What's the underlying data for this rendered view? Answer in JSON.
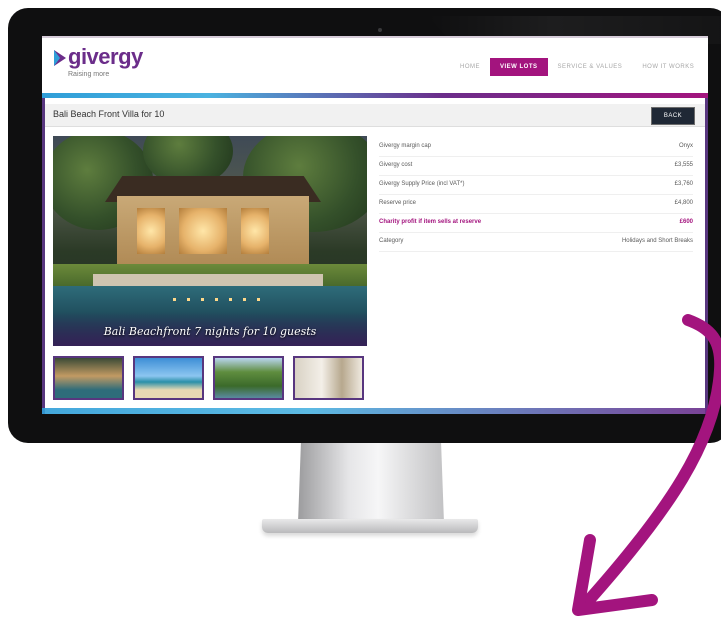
{
  "site": {
    "logo_text": "givergy",
    "logo_tagline": "Raising more"
  },
  "nav": {
    "items": [
      {
        "label": "HOME",
        "active": false
      },
      {
        "label": "VIEW LOTS",
        "active": true
      },
      {
        "label": "SERVICE & VALUES",
        "active": false
      },
      {
        "label": "HOW IT WORKS",
        "active": false
      }
    ]
  },
  "page": {
    "title": "Bali Beach Front Villa for 10",
    "back_label": "BACK",
    "photo_caption": "Bali Beachfront 7 nights for 10 guests"
  },
  "details": [
    {
      "label": "Givergy margin cap",
      "value": "Onyx",
      "highlight": false
    },
    {
      "label": "Givergy cost",
      "value": "£3,555",
      "highlight": false
    },
    {
      "label": "Givergy Supply Price (incl VAT*)",
      "value": "£3,760",
      "highlight": false
    },
    {
      "label": "Reserve price",
      "value": "£4,800",
      "highlight": false
    },
    {
      "label": "Charity profit if item sells at reserve",
      "value": "£600",
      "highlight": true
    },
    {
      "label": "Category",
      "value": "Holidays and Short Breaks",
      "highlight": false
    }
  ],
  "thumbnails": [
    {
      "subject": "villa-pool-night"
    },
    {
      "subject": "beach"
    },
    {
      "subject": "garden-pavilion"
    },
    {
      "subject": "bathroom-interior"
    }
  ],
  "colors": {
    "brand_purple": "#6b2d8a",
    "brand_magenta": "#a3147e",
    "brand_blue": "#2f9ed8",
    "arrow": "#a3147e",
    "back_button": "#1f2835"
  }
}
